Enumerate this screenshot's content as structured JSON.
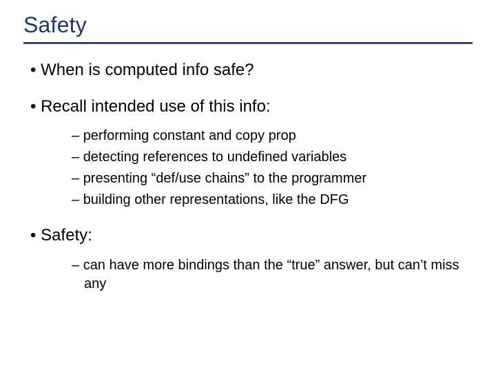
{
  "title": "Safety",
  "bullets": [
    {
      "text": "When is computed info safe?"
    },
    {
      "text": "Recall intended use of this info:",
      "sub": [
        "performing constant and copy prop",
        "detecting references to undefined variables",
        "presenting “def/use chains” to the programmer",
        "building other representations, like the DFG"
      ]
    },
    {
      "text": "Safety:",
      "sub": [
        "can have more bindings than the “true” answer, but can’t miss any"
      ]
    }
  ]
}
